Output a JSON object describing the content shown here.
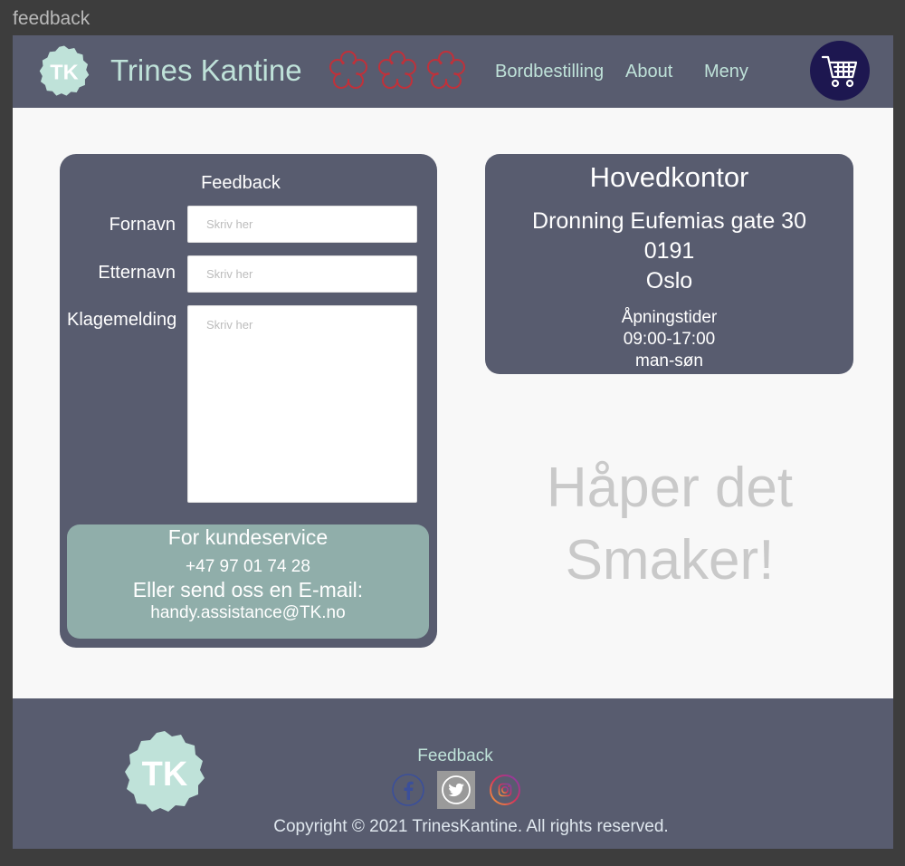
{
  "window": {
    "title": "feedback"
  },
  "header": {
    "logo_text": "TK",
    "brand": "Trines Kantine",
    "nav": [
      "Bordbestilling",
      "About",
      "Meny"
    ],
    "icons": {
      "stars": "flower-outline-icon",
      "cart": "shopping-cart-icon"
    }
  },
  "feedback": {
    "title": "Feedback",
    "fields": {
      "first_name_label": "Fornavn",
      "last_name_label": "Etternavn",
      "message_label": "Klagemelding",
      "placeholder": "Skriv her"
    },
    "service": {
      "title": "For kundeservice",
      "phone": "+47 97 01 74 28",
      "email_prompt": "Eller send oss en E-mail:",
      "email": "handy.assistance@TK.no"
    }
  },
  "office": {
    "title": "Hovedkontor",
    "street": "Dronning Eufemias gate 30",
    "postcode": "0191",
    "city": "Oslo",
    "hours_title": "Åpningstider",
    "hours": "09:00-17:00",
    "days": "man-søn"
  },
  "tagline": {
    "line1": "Håper det",
    "line2": "Smaker!"
  },
  "footer": {
    "logo_text": "TK",
    "link": "Feedback",
    "social": [
      "facebook-icon",
      "twitter-icon",
      "instagram-icon"
    ],
    "copyright": "Copyright © 2021 TrinesKantine. All rights reserved."
  },
  "colors": {
    "header_bg": "#585c6f",
    "accent_mint": "#bfe2d9",
    "star_red": "#c0313a",
    "cart_bg": "#1d1750",
    "service_bg": "#90aeaa",
    "page_bg": "#f8f8f8"
  }
}
